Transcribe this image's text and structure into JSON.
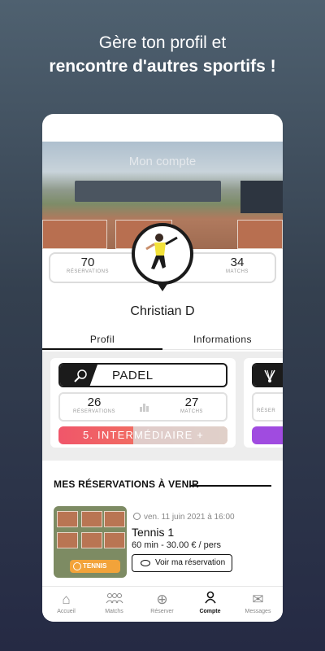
{
  "headline": {
    "line1": "Gère ton profil et",
    "line2": "rencontre d'autres sportifs !"
  },
  "profile": {
    "screen_title": "Mon compte",
    "name": "Christian  D",
    "stats": [
      {
        "value": "70",
        "label": "RÉSERVATIONS"
      },
      {
        "value": "34",
        "label": "MATCHS"
      }
    ]
  },
  "tabs": [
    {
      "label": "Profil",
      "active": true
    },
    {
      "label": "Informations",
      "active": false
    }
  ],
  "sports": [
    {
      "name": "PADEL",
      "icon": "padel-racket-icon",
      "reservations": {
        "value": "26",
        "label": "RÉSERVATIONS"
      },
      "matchs": {
        "value": "27",
        "label": "MATCHS"
      },
      "level": "5. INTERMÉDIAIRE +",
      "level_colors": [
        "#f0566a",
        "#f28659"
      ]
    },
    {
      "icon": "badminton-shuttle-icon",
      "partial_label": "RÉSER",
      "level_color": "#a04be0"
    }
  ],
  "upcoming": {
    "title": "MES RÉSERVATIONS À VENIR",
    "items": [
      {
        "date": "ven. 11 juin 2021 à 16:00",
        "title": "Tennis 1",
        "details": "60 min - 30.00 € / pers",
        "button": "Voir ma réservation",
        "sport_tag": "TENNIS"
      }
    ]
  },
  "nav": [
    {
      "label": "Accueil",
      "icon": "home-icon",
      "active": false
    },
    {
      "label": "Matchs",
      "icon": "people-icon",
      "active": false
    },
    {
      "label": "Réserver",
      "icon": "plus-circle-icon",
      "active": false
    },
    {
      "label": "Compte",
      "icon": "user-icon",
      "active": true
    },
    {
      "label": "Messages",
      "icon": "mail-icon",
      "active": false
    }
  ]
}
